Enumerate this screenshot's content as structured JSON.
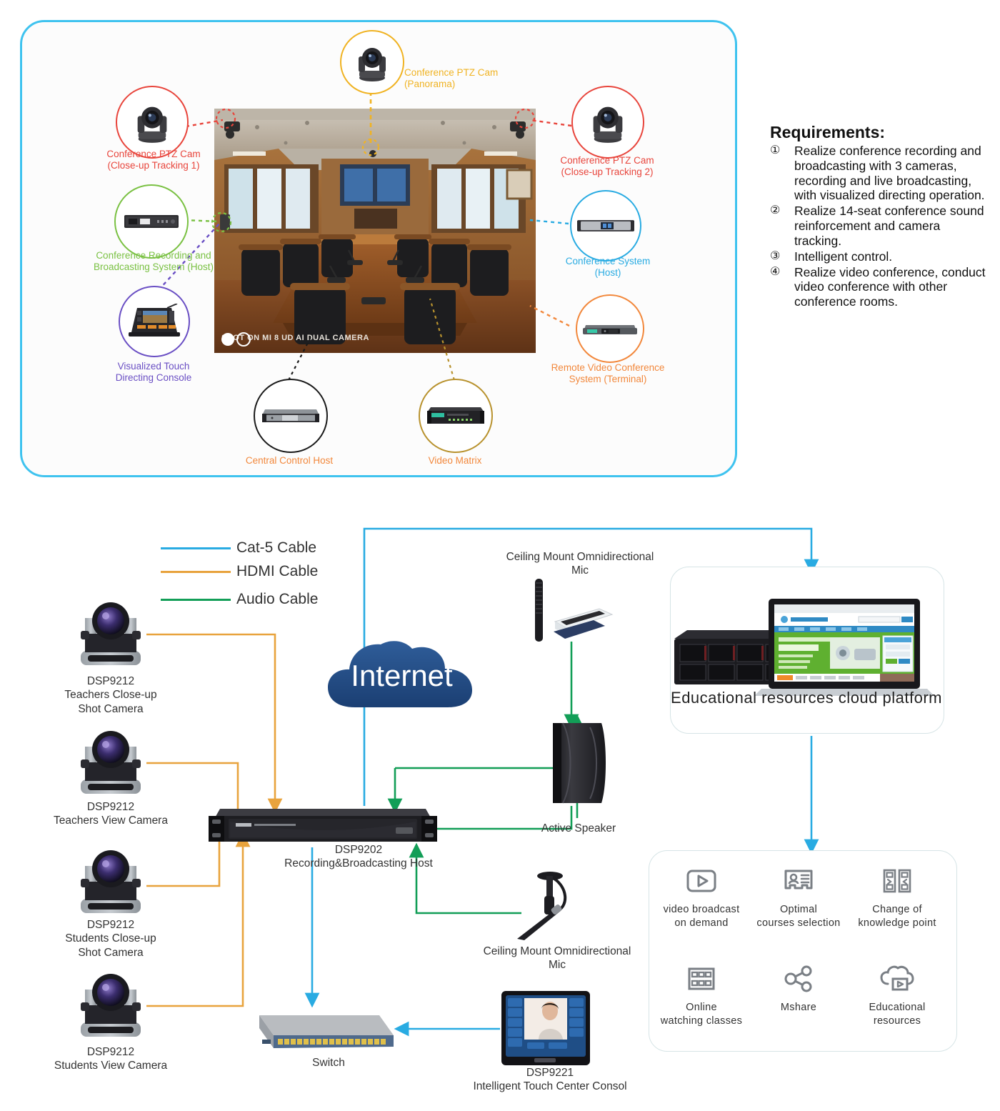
{
  "colors": {
    "panel_border": "#3fc3ef",
    "red": "#e8453c",
    "yellow": "#f0b323",
    "green": "#7ac143",
    "purple": "#6a4fc4",
    "cyan": "#29abe2",
    "orange": "#f2883c",
    "black": "#1a1a1a",
    "gold": "#b8922e",
    "cat5": "#29abe2",
    "hdmi": "#e8a33d",
    "audio": "#129e57"
  },
  "top_diagram": {
    "photo_overlay": "SHOT ON MI 8 UD\nAI DUAL CAMERA",
    "callouts": [
      {
        "id": "ptz-panorama",
        "label": "Conference PTZ Cam\n(Panorama)",
        "color": "#f0b323",
        "icon": "ptz-camera-icon"
      },
      {
        "id": "ptz-closeup-1",
        "label": "Conference PTZ Cam\n(Close-up Tracking 1)",
        "color": "#e8453c",
        "icon": "ptz-camera-icon"
      },
      {
        "id": "ptz-closeup-2",
        "label": "Conference PTZ Cam\n(Close-up Tracking 2)",
        "color": "#e8453c",
        "icon": "ptz-camera-icon"
      },
      {
        "id": "recording-broadcasting-host",
        "label": "Conference Recording and\nBroadcasting System (Host)",
        "color": "#7ac143",
        "icon": "rack-unit-icon"
      },
      {
        "id": "visualized-touch-console",
        "label": "Visualized Touch\nDirecting Console",
        "color": "#6a4fc4",
        "icon": "touch-console-icon"
      },
      {
        "id": "conference-system-host",
        "label": "Conference System\n(Host)",
        "color": "#29abe2",
        "icon": "rack-unit-icon"
      },
      {
        "id": "remote-video-conference",
        "label": "Remote Video Conference\nSystem (Terminal)",
        "color": "#f2883c",
        "icon": "video-terminal-icon"
      },
      {
        "id": "central-control-host",
        "label": "Central Control Host",
        "color": "#f2883c",
        "icon": "rack-unit-icon"
      },
      {
        "id": "video-matrix",
        "label": "Video Matrix",
        "color": "#f2883c",
        "icon": "rack-matrix-icon"
      }
    ]
  },
  "requirements": {
    "title": "Requirements:",
    "items": [
      {
        "num": "①",
        "text": "Realize conference recording and broadcasting with 3 cameras, recording and live broadcasting, with visualized directing operation."
      },
      {
        "num": "②",
        "text": "Realize 14-seat conference sound reinforcement and camera tracking."
      },
      {
        "num": "③",
        "text": "Intelligent control."
      },
      {
        "num": "④",
        "text": "Realize video conference, conduct video conference with other conference rooms."
      }
    ]
  },
  "bottom_diagram": {
    "legend": [
      {
        "label": "Cat-5 Cable",
        "color": "#29abe2"
      },
      {
        "label": "HDMI Cable",
        "color": "#e8a33d"
      },
      {
        "label": "Audio Cable",
        "color": "#129e57"
      }
    ],
    "cloud_label": "Internet",
    "nodes": [
      {
        "id": "teachers-closeup-camera",
        "label": "DSP9212\nTeachers Close-up\nShot Camera"
      },
      {
        "id": "teachers-view-camera",
        "label": "DSP9212\nTeachers View Camera"
      },
      {
        "id": "students-closeup-camera",
        "label": "DSP9212\nStudents Close-up\nShot Camera"
      },
      {
        "id": "students-view-camera",
        "label": "DSP9212\nStudents View Camera"
      },
      {
        "id": "recording-broadcasting-host",
        "label": "DSP9202\nRecording&Broadcasting Host"
      },
      {
        "id": "ceiling-mic-top",
        "label": "Ceiling Mount Omnidirectional\nMic"
      },
      {
        "id": "active-speaker",
        "label": "Active Speaker"
      },
      {
        "id": "ceiling-mic-bottom",
        "label": "Ceiling Mount Omnidirectional\nMic"
      },
      {
        "id": "switch",
        "label": "Switch"
      },
      {
        "id": "touch-center-console",
        "label": "DSP9221\nIntelligent Touch Center Consol"
      }
    ],
    "edu_platform_caption": "Educational resources\ncloud platform",
    "features": [
      {
        "id": "video-broadcast-on-demand",
        "label": "video broadcast\non demand",
        "icon": "play-box-icon"
      },
      {
        "id": "optimal-courses-selection",
        "label": "Optimal\ncourses selection",
        "icon": "id-card-icon"
      },
      {
        "id": "change-of-knowledge-point",
        "label": "Change of\nknowledge point",
        "icon": "code-panels-icon"
      },
      {
        "id": "online-watching-classes",
        "label": "Online\nwatching classes",
        "icon": "film-strip-icon"
      },
      {
        "id": "mshare",
        "label": "Mshare",
        "icon": "share-nodes-icon"
      },
      {
        "id": "educational-resources",
        "label": "Educational\nresources",
        "icon": "cloud-play-icon"
      }
    ]
  }
}
